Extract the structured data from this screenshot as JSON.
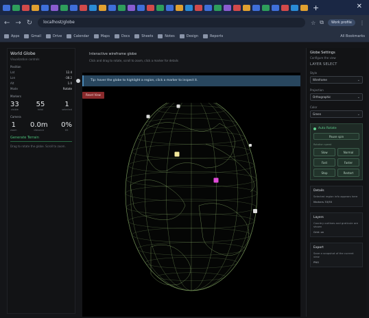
{
  "browser": {
    "tab_favicon_colors": [
      "#3f6fd9",
      "#2e9e5b",
      "#d24a4a",
      "#e0a030",
      "#3f6fd9",
      "#8a5cd0",
      "#2e9e5b",
      "#3f6fd9",
      "#d24a4a",
      "#2a8bd6",
      "#e0a030",
      "#3f6fd9",
      "#2e9e5b",
      "#8a5cd0",
      "#3f6fd9",
      "#d24a4a",
      "#2e9e5b",
      "#3f6fd9",
      "#e0a030",
      "#2a8bd6",
      "#d24a4a",
      "#3f6fd9",
      "#2e9e5b",
      "#8a5cd0",
      "#d24a4a",
      "#e0a030",
      "#3f6fd9",
      "#2e9e5b",
      "#3f6fd9",
      "#d24a4a",
      "#2a8bd6",
      "#e0a030"
    ],
    "new_tab": "+",
    "close": "✕",
    "nav": {
      "back": "←",
      "forward": "→",
      "reload": "↻"
    },
    "url": "localhost/globe",
    "profile": "Work profile",
    "bookmarks": [
      "Apps",
      "Gmail",
      "Drive",
      "Calendar",
      "Maps",
      "Docs",
      "Sheets",
      "Notes",
      "Design",
      "Reports"
    ],
    "all_bookmarks": "All Bookmarks"
  },
  "left": {
    "title": "World Globe",
    "subtitle": "Visualization controls",
    "position_label": "Position",
    "rows": [
      {
        "k": "Lat",
        "v": "12.4"
      },
      {
        "k": "Lon",
        "v": "-38.2"
      },
      {
        "k": "Alt",
        "v": "1.0"
      },
      {
        "k": "Mode",
        "v": "Rotate"
      }
    ],
    "metrics_label": "Markers",
    "stats_a": [
      {
        "n": "33",
        "l": "visible"
      },
      {
        "n": "55",
        "l": "total"
      },
      {
        "n": "1",
        "l": "selected"
      }
    ],
    "camera_label": "Camera",
    "stats_b": [
      {
        "n": "1",
        "l": "zoom"
      },
      {
        "n": "0.0m",
        "l": "distance"
      },
      {
        "n": "0%",
        "l": "tilt"
      }
    ],
    "action": "Generate Terrain",
    "note": "Drag to rotate the globe. Scroll to zoom."
  },
  "center": {
    "info_title": "Interactive wireframe globe",
    "info_sub": "Click and drag to rotate, scroll to zoom, click a marker for details",
    "hint": "Tip: hover the globe to highlight a region, click a marker to inspect it.",
    "reset": "Reset View"
  },
  "right": {
    "title": "Globe Settings",
    "subtitle": "Configure the view",
    "big": "LAYER SELECT",
    "dropdowns": [
      {
        "label": "Style",
        "value": "Wireframe"
      },
      {
        "label": "Projection",
        "value": "Orthographic"
      },
      {
        "label": "Color",
        "value": "Green"
      }
    ],
    "controls": {
      "title": "Auto Rotate",
      "toggle": "Pause spin",
      "speed_label": "Rotation speed",
      "buttons": [
        "Slow",
        "Normal",
        "Fast",
        "Faster",
        "Stop",
        "Restart"
      ]
    },
    "cards": [
      {
        "h": "Details",
        "b": "Selected region info appears here",
        "m": "Markers 33/55"
      },
      {
        "h": "Layers",
        "b": "Country outlines and graticule are shown",
        "m": "Grid: on"
      },
      {
        "h": "Export",
        "b": "Save a snapshot of the current view",
        "m": "PNG"
      }
    ]
  },
  "colors": {
    "globe_line": "#8fb56b",
    "marker_yellow": "#f2e79a",
    "marker_magenta": "#e14bd8",
    "marker_white": "#dddddd"
  }
}
